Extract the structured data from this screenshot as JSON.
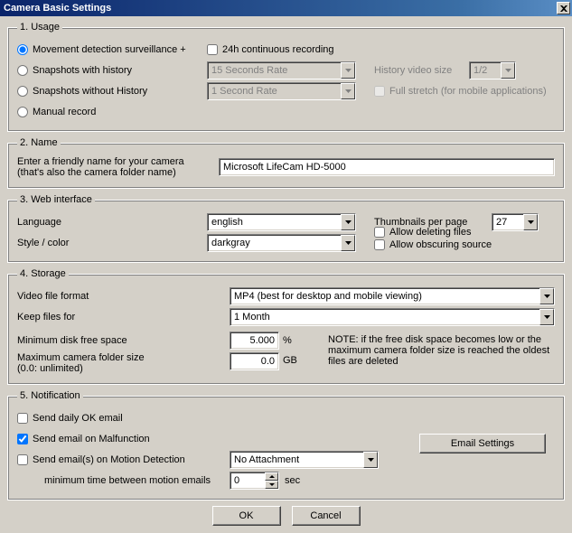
{
  "window": {
    "title": "Camera Basic Settings"
  },
  "usage": {
    "legend": "1. Usage",
    "opt_movement": "Movement detection surveillance  +",
    "opt_snap_hist": "Snapshots with history",
    "opt_snap_nohist": "Snapshots without History",
    "opt_manual": "Manual record",
    "chk_24h": "24h continuous recording",
    "snap_rate_hist": "15 Seconds Rate",
    "snap_rate_nohist": "1 Second Rate",
    "history_size_label": "History video size",
    "history_size_value": "1/2",
    "full_stretch": "Full stretch (for mobile applications)"
  },
  "name": {
    "legend": "2. Name",
    "label_l1": "Enter a friendly name for your camera",
    "label_l2": "(that's also the camera folder name)",
    "value": "Microsoft LifeCam HD-5000"
  },
  "web": {
    "legend": "3. Web interface",
    "lang_label": "Language",
    "lang_value": "english",
    "style_label": "Style / color",
    "style_value": "darkgray",
    "thumbs_label": "Thumbnails per page",
    "thumbs_value": "27",
    "allow_delete": "Allow deleting files",
    "allow_obscure": "Allow obscuring source"
  },
  "storage": {
    "legend": "4. Storage",
    "format_label": "Video file format",
    "format_value": "MP4 (best for desktop and mobile viewing)",
    "keep_label": "Keep files for",
    "keep_value": "1 Month",
    "mindisk_label": "Minimum disk free space",
    "mindisk_value": "5.000",
    "mindisk_unit": "%",
    "maxfolder_label_l1": "Maximum camera folder size",
    "maxfolder_label_l2": "(0.0: unlimited)",
    "maxfolder_value": "0.0",
    "maxfolder_unit": "GB",
    "note": "NOTE: if the free disk space becomes low or the maximum camera folder size is reached the oldest files are deleted"
  },
  "notif": {
    "legend": "5. Notification",
    "daily_ok": "Send daily OK email",
    "malfunction": "Send email on Malfunction",
    "motion": "Send email(s) on Motion Detection",
    "attach_value": "No Attachment",
    "min_time_label": "minimum time between motion emails",
    "min_time_value": "0",
    "min_time_unit": "sec",
    "email_settings": "Email Settings"
  },
  "buttons": {
    "ok": "OK",
    "cancel": "Cancel"
  }
}
